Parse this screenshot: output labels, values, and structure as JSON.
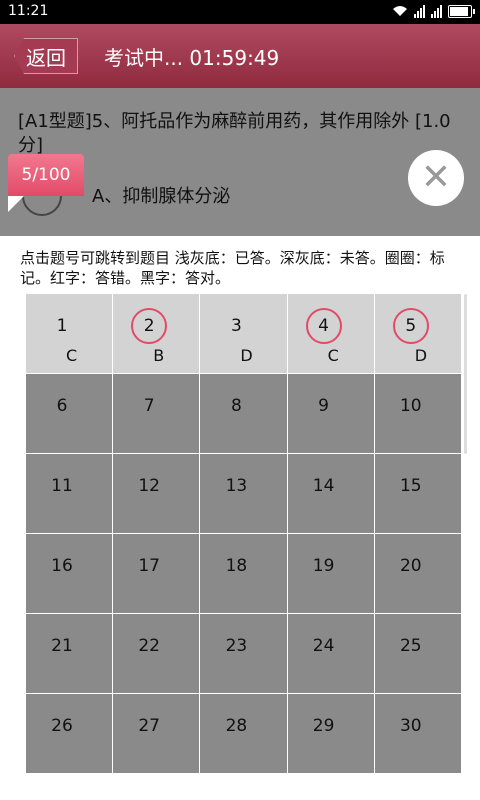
{
  "status_bar": {
    "time": "11:21"
  },
  "header": {
    "back_label": "返回",
    "title": "考试中...  01:59:49"
  },
  "question": {
    "text": "[A1型题]5、阿托品作为麻醉前用药，其作用除外 [1.0分]",
    "option_text": "A、抑制腺体分泌"
  },
  "progress": {
    "label": "5/100"
  },
  "panel": {
    "legend": "点击题号可跳转到题目 浅灰底：已答。深灰底：未答。圈圈：标记。红字：答错。黑字：答对。",
    "cells": [
      {
        "num": "1",
        "answer": "C",
        "answered": true,
        "marked": false
      },
      {
        "num": "2",
        "answer": "B",
        "answered": true,
        "marked": true
      },
      {
        "num": "3",
        "answer": "D",
        "answered": true,
        "marked": false
      },
      {
        "num": "4",
        "answer": "C",
        "answered": true,
        "marked": true
      },
      {
        "num": "5",
        "answer": "D",
        "answered": true,
        "marked": true
      },
      {
        "num": "6",
        "answer": "",
        "answered": false,
        "marked": false
      },
      {
        "num": "7",
        "answer": "",
        "answered": false,
        "marked": false
      },
      {
        "num": "8",
        "answer": "",
        "answered": false,
        "marked": false
      },
      {
        "num": "9",
        "answer": "",
        "answered": false,
        "marked": false
      },
      {
        "num": "10",
        "answer": "",
        "answered": false,
        "marked": false
      },
      {
        "num": "11",
        "answer": "",
        "answered": false,
        "marked": false
      },
      {
        "num": "12",
        "answer": "",
        "answered": false,
        "marked": false
      },
      {
        "num": "13",
        "answer": "",
        "answered": false,
        "marked": false
      },
      {
        "num": "14",
        "answer": "",
        "answered": false,
        "marked": false
      },
      {
        "num": "15",
        "answer": "",
        "answered": false,
        "marked": false
      },
      {
        "num": "16",
        "answer": "",
        "answered": false,
        "marked": false
      },
      {
        "num": "17",
        "answer": "",
        "answered": false,
        "marked": false
      },
      {
        "num": "18",
        "answer": "",
        "answered": false,
        "marked": false
      },
      {
        "num": "19",
        "answer": "",
        "answered": false,
        "marked": false
      },
      {
        "num": "20",
        "answer": "",
        "answered": false,
        "marked": false
      },
      {
        "num": "21",
        "answer": "",
        "answered": false,
        "marked": false
      },
      {
        "num": "22",
        "answer": "",
        "answered": false,
        "marked": false
      },
      {
        "num": "23",
        "answer": "",
        "answered": false,
        "marked": false
      },
      {
        "num": "24",
        "answer": "",
        "answered": false,
        "marked": false
      },
      {
        "num": "25",
        "answer": "",
        "answered": false,
        "marked": false
      },
      {
        "num": "26",
        "answer": "",
        "answered": false,
        "marked": false
      },
      {
        "num": "27",
        "answer": "",
        "answered": false,
        "marked": false
      },
      {
        "num": "28",
        "answer": "",
        "answered": false,
        "marked": false
      },
      {
        "num": "29",
        "answer": "",
        "answered": false,
        "marked": false
      },
      {
        "num": "30",
        "answer": "",
        "answered": false,
        "marked": false
      }
    ]
  }
}
